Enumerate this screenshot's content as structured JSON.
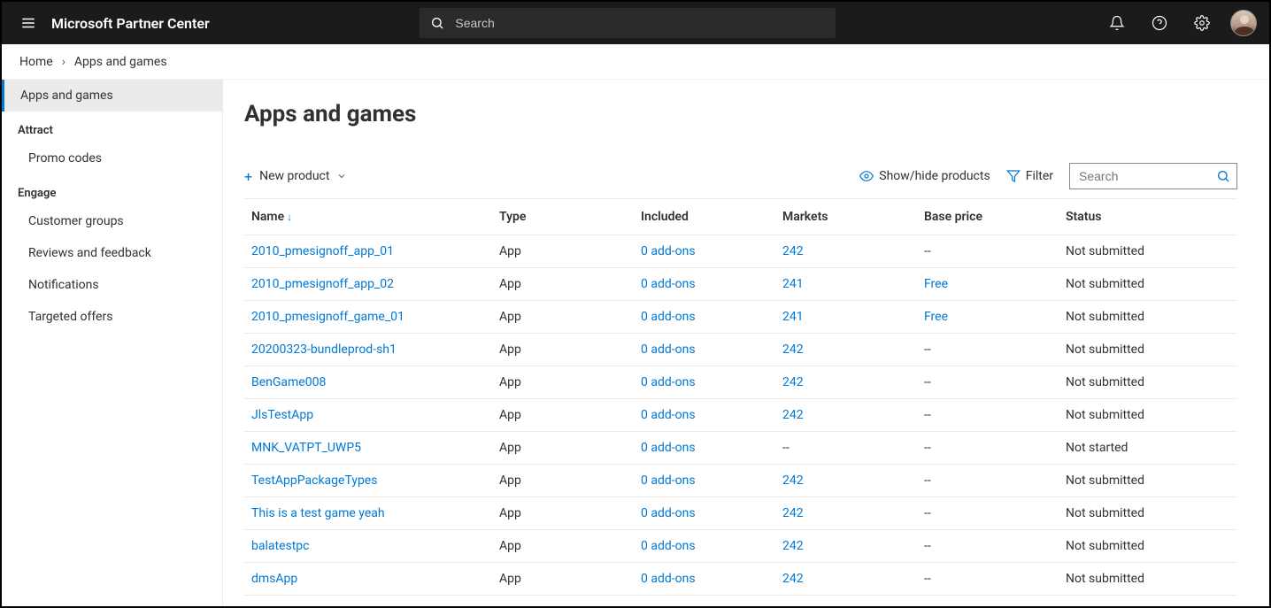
{
  "topbar": {
    "brand": "Microsoft Partner Center",
    "search_placeholder": "Search"
  },
  "breadcrumb": {
    "home": "Home",
    "current": "Apps and games"
  },
  "sidebar": {
    "top_item": "Apps and games",
    "sections": [
      {
        "heading": "Attract",
        "items": [
          "Promo codes"
        ]
      },
      {
        "heading": "Engage",
        "items": [
          "Customer groups",
          "Reviews and feedback",
          "Notifications",
          "Targeted offers"
        ]
      }
    ]
  },
  "page": {
    "title": "Apps and games",
    "new_product": "New product",
    "show_hide": "Show/hide products",
    "filter": "Filter",
    "filter_search_placeholder": "Search"
  },
  "table": {
    "columns": {
      "name": "Name",
      "type": "Type",
      "included": "Included",
      "markets": "Markets",
      "base_price": "Base price",
      "status": "Status"
    },
    "rows": [
      {
        "name": "2010_pmesignoff_app_01",
        "type": "App",
        "included": "0 add-ons",
        "markets": "242",
        "base_price": "--",
        "status": "Not submitted"
      },
      {
        "name": "2010_pmesignoff_app_02",
        "type": "App",
        "included": "0 add-ons",
        "markets": "241",
        "base_price": "Free",
        "status": "Not submitted"
      },
      {
        "name": "2010_pmesignoff_game_01",
        "type": "App",
        "included": "0 add-ons",
        "markets": "241",
        "base_price": "Free",
        "status": "Not submitted"
      },
      {
        "name": "20200323-bundleprod-sh1",
        "type": "App",
        "included": "0 add-ons",
        "markets": "242",
        "base_price": "--",
        "status": "Not submitted"
      },
      {
        "name": "BenGame008",
        "type": "App",
        "included": "0 add-ons",
        "markets": "242",
        "base_price": "--",
        "status": "Not submitted"
      },
      {
        "name": "JlsTestApp",
        "type": "App",
        "included": "0 add-ons",
        "markets": "242",
        "base_price": "--",
        "status": "Not submitted"
      },
      {
        "name": "MNK_VATPT_UWP5",
        "type": "App",
        "included": "0 add-ons",
        "markets": "--",
        "base_price": "--",
        "status": "Not started"
      },
      {
        "name": "TestAppPackageTypes",
        "type": "App",
        "included": "0 add-ons",
        "markets": "242",
        "base_price": "--",
        "status": "Not submitted"
      },
      {
        "name": "This is a test game yeah",
        "type": "App",
        "included": "0 add-ons",
        "markets": "242",
        "base_price": "--",
        "status": "Not submitted"
      },
      {
        "name": "balatestpc",
        "type": "App",
        "included": "0 add-ons",
        "markets": "242",
        "base_price": "--",
        "status": "Not submitted"
      },
      {
        "name": "dmsApp",
        "type": "App",
        "included": "0 add-ons",
        "markets": "242",
        "base_price": "--",
        "status": "Not submitted"
      }
    ]
  }
}
